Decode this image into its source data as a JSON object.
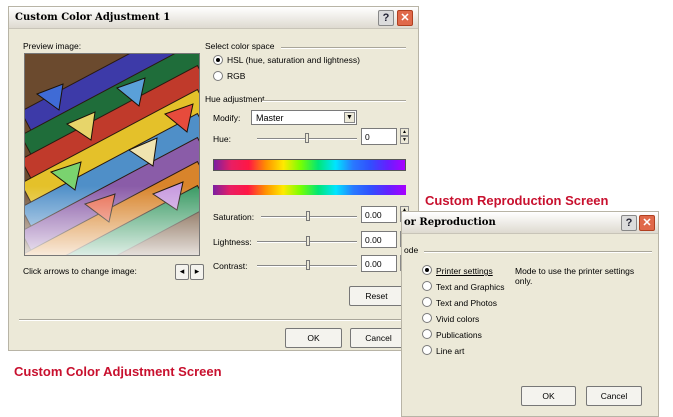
{
  "color_dialog": {
    "title": "Custom Color Adjustment 1",
    "help_glyph": "?",
    "close_glyph": "✕",
    "preview_label": "Preview image:",
    "arrows_hint": "Click arrows to change image:",
    "prev_glyph": "◂",
    "next_glyph": "▸",
    "color_space_heading": "Select color space",
    "hsl_label": "HSL (hue, saturation and lightness)",
    "rgb_label": "RGB",
    "hue_heading": "Hue adjustment",
    "modify_label": "Modify:",
    "modify_value": "Master",
    "hue_label": "Hue:",
    "hue_value": "0",
    "saturation_label": "Saturation:",
    "saturation_value": "0.00",
    "lightness_label": "Lightness:",
    "lightness_value": "0.00",
    "contrast_label": "Contrast:",
    "contrast_value": "0.00",
    "reset_label": "Reset",
    "ok_label": "OK",
    "cancel_label": "Cancel"
  },
  "repro_dialog": {
    "title": "or Reproduction",
    "help_glyph": "?",
    "close_glyph": "✕",
    "mode_heading": "ode",
    "modes": [
      "Printer settings",
      "Text and Graphics",
      "Text and Photos",
      "Vivid colors",
      "Publications",
      "Line art"
    ],
    "selected_mode": "Printer settings",
    "description": "Mode to use the printer settings only.",
    "ok_label": "OK",
    "cancel_label": "Cancel"
  },
  "captions": {
    "color_adjust": "Custom Color Adjustment Screen",
    "reproduction": "Custom Reproduction Screen"
  },
  "colors": {
    "caption_red": "#c8102e",
    "dialog_bg": "#ece9d8",
    "close_button": "#e0694a"
  }
}
